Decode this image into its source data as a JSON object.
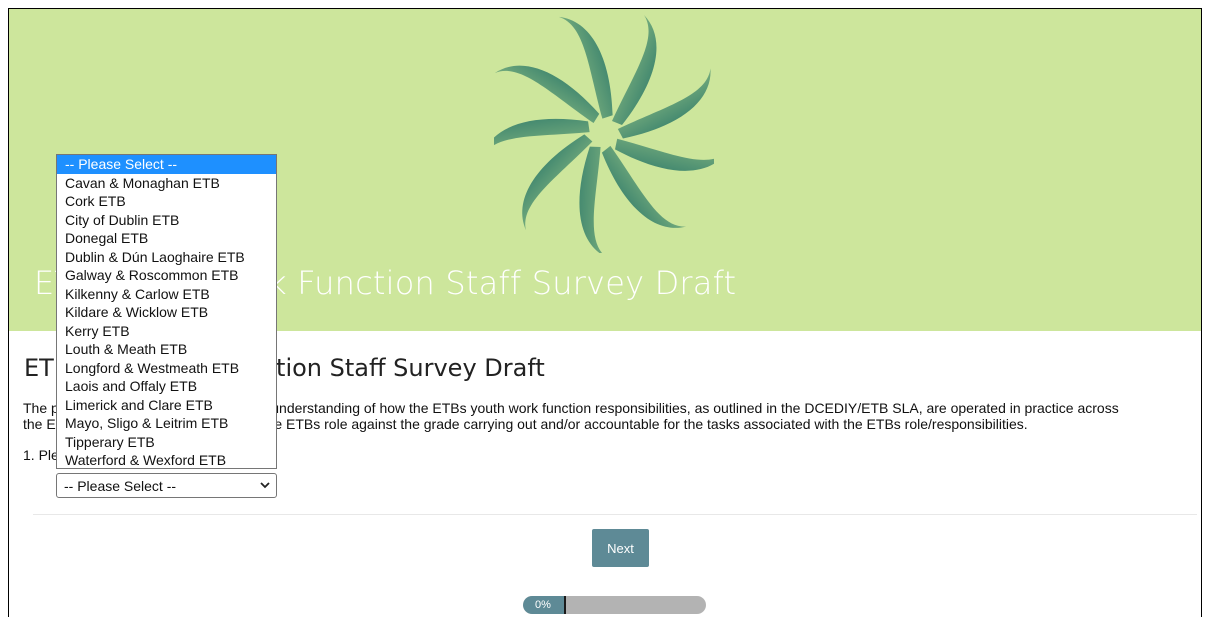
{
  "hero": {
    "title": "ETB Youth Work Function Staff Survey Draft"
  },
  "main": {
    "title": "ETB Youth Work Function Staff Survey Draft",
    "intro_line1": "The purpose of this survey is to gain an understanding of how the ETBs youth work function responsibilities, as outlined in the DCEDIY/ETB SLA, are operated in practice across",
    "intro_line2": "the ETB network. It also seeks to map the ETBs role against the grade carrying out and/or accountable for the tasks associated with the ETBs role/responsibilities.",
    "question": "1. Please select your ETB"
  },
  "etb_select": {
    "selected": "-- Please Select --",
    "options": [
      "-- Please Select --",
      "Cavan & Monaghan ETB",
      "Cork ETB",
      "City of Dublin ETB",
      "Donegal ETB",
      "Dublin & Dún Laoghaire ETB",
      "Galway & Roscommon ETB",
      "Kilkenny & Carlow ETB",
      "Kildare & Wicklow ETB",
      "Kerry ETB",
      "Louth & Meath ETB",
      "Longford & Westmeath ETB",
      "Laois and Offaly ETB",
      "Limerick and Clare ETB",
      "Mayo, Sligo & Leitrim ETB",
      "Tipperary ETB",
      "Waterford & Wexford ETB"
    ]
  },
  "navigation": {
    "next_label": "Next"
  },
  "progress": {
    "label": "0%",
    "value": 0
  },
  "colors": {
    "hero_background": "#cde69c",
    "accent": "#5e8a96",
    "option_highlight": "#1e90ff"
  },
  "icons": {
    "logo": "swirl-logo-icon",
    "select_chevron": "chevron-down-icon"
  }
}
